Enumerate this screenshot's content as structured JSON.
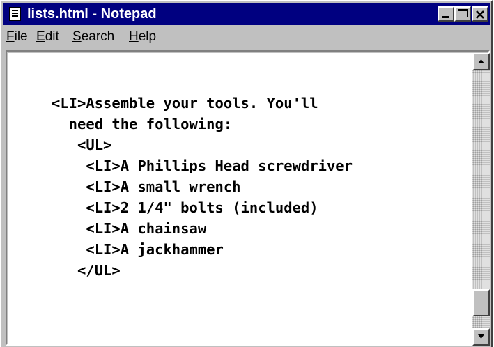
{
  "window": {
    "title": "lists.html - Notepad",
    "title_bar_color": "#000080",
    "app_icon": "notepad-icon"
  },
  "title_buttons": {
    "minimize_icon": "minimize-icon",
    "maximize_icon": "maximize-icon",
    "close_icon": "close-icon"
  },
  "menu": {
    "items": [
      {
        "mnemonic": "F",
        "rest": "ile"
      },
      {
        "mnemonic": "E",
        "rest": "dit"
      },
      {
        "mnemonic": "S",
        "rest": "earch"
      },
      {
        "mnemonic": "H",
        "rest": "elp"
      }
    ]
  },
  "editor": {
    "lines": [
      "<LI>Assemble your tools. You'll",
      "  need the following:",
      "   <UL>",
      "    <LI>A Phillips Head screwdriver",
      "    <LI>A small wrench",
      "    <LI>2 1/4\" bolts (included)",
      "    <LI>A chainsaw",
      "    <LI>A jackhammer",
      "   </UL>"
    ]
  },
  "scrollbar": {
    "up_icon": "scroll-up-arrow-icon",
    "down_icon": "scroll-down-arrow-icon",
    "position_fraction": 0.95
  }
}
